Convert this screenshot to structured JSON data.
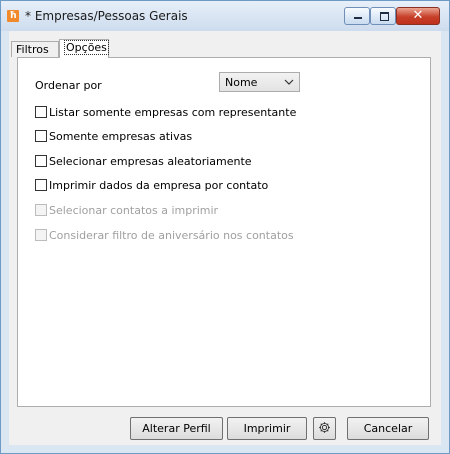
{
  "window": {
    "title": "* Empresas/Pessoas Gerais",
    "close_glyph": "✕"
  },
  "tabs": [
    {
      "label": "Filtros",
      "selected": false
    },
    {
      "label": "Opções",
      "selected": true
    }
  ],
  "options": {
    "order_label": "Ordenar por",
    "order_value": "Nome",
    "checkboxes": [
      {
        "label": "Listar somente empresas com representante",
        "checked": false,
        "enabled": true
      },
      {
        "label": "Somente empresas ativas",
        "checked": false,
        "enabled": true
      },
      {
        "label": "Selecionar empresas aleatoriamente",
        "checked": false,
        "enabled": true
      },
      {
        "label": "Imprimir dados da empresa por contato",
        "checked": false,
        "enabled": true
      },
      {
        "label": "Selecionar contatos a imprimir",
        "checked": false,
        "enabled": false
      },
      {
        "label": "Considerar filtro de aniversário nos contatos",
        "checked": false,
        "enabled": false
      }
    ]
  },
  "buttons": {
    "alterar_perfil": "Alterar Perfil",
    "imprimir": "Imprimir",
    "configuracoes_icon": "gear-icon",
    "cancelar": "Cancelar"
  },
  "colors": {
    "title_bar_border": "#6d9bc5",
    "close_button": "#c7402a",
    "app_icon": "#f08a2a"
  }
}
